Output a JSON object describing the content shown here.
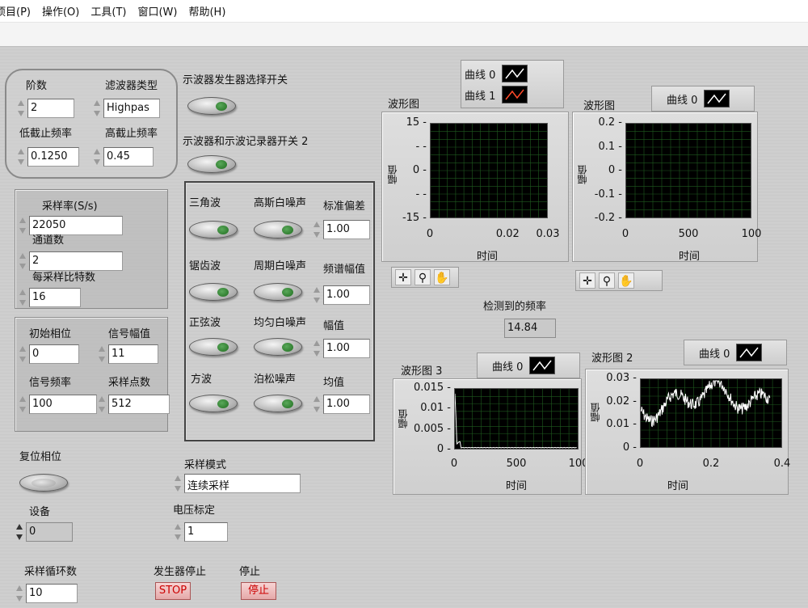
{
  "menu": [
    "项目(P)",
    "操作(O)",
    "工具(T)",
    "窗口(W)",
    "帮助(H)"
  ],
  "filter": {
    "order_label": "阶数",
    "order_value": "2",
    "type_label": "滤波器类型",
    "type_value": "Highpas",
    "low_label": "低截止频率",
    "low_value": "0.1250",
    "high_label": "高截止频率",
    "high_value": "0.45"
  },
  "sampling": {
    "rate_label": "采样率(S/s)",
    "rate_value": "22050",
    "channels_label": "通道数",
    "channels_value": "2",
    "bits_label": "每采样比特数",
    "bits_value": "16"
  },
  "signal": {
    "phase_label": "初始相位",
    "phase_value": "0",
    "amp_label": "信号幅值",
    "amp_value": "11",
    "freq_label": "信号频率",
    "freq_value": "100",
    "points_label": "采样点数",
    "points_value": "512"
  },
  "reset_phase_label": "复位相位",
  "device_label": "设备",
  "device_value": "0",
  "loop_label": "采样循环数",
  "loop_value": "10",
  "gen_stop_label": "发生器停止",
  "gen_stop_button": "STOP",
  "stop_label": "停止",
  "stop_button": "停止",
  "switch1_label": "示波器发生器选择开关",
  "switch2_label": "示波器和示波记录器开关 2",
  "waves": {
    "triangle": "三角波",
    "gauss": "高斯白噪声",
    "stddev_label": "标准偏差",
    "stddev_value": "1.00",
    "saw": "锯齿波",
    "periodic": "周期白噪声",
    "spectrum_label": "频谱幅值",
    "spectrum_value": "1.00",
    "sine": "正弦波",
    "uniform": "均匀白噪声",
    "amp_label": "幅值",
    "amp_value": "1.00",
    "square": "方波",
    "poisson": "泊松噪声",
    "mean_label": "均值",
    "mean_value": "1.00"
  },
  "mode_label": "采样模式",
  "mode_value": "连续采样",
  "voltage_label": "电压标定",
  "voltage_value": "1",
  "freq_detect_label": "检测到的频率",
  "freq_detect_value": "14.84",
  "graphs": {
    "g1": {
      "title": "波形图",
      "ylabel": "幅值",
      "xlabel": "时间",
      "legend": [
        "曲线 0",
        "曲线 1"
      ],
      "yticks": [
        "15",
        "-",
        "0",
        "-",
        "-15"
      ],
      "xticks": [
        "0",
        "0.02",
        "0.03"
      ]
    },
    "g2": {
      "title": "波形图",
      "ylabel": "幅值",
      "xlabel": "时间",
      "legend": [
        "曲线 0"
      ],
      "yticks": [
        "0.2",
        "0.1",
        "0",
        "-0.1",
        "-0.2"
      ],
      "xticks": [
        "0",
        "500",
        "100"
      ]
    },
    "g3": {
      "title": "波形图 3",
      "ylabel": "幅值",
      "xlabel": "时间",
      "legend": [
        "曲线 0"
      ],
      "yticks": [
        "0.015",
        "0.01",
        "0.005",
        "0"
      ],
      "xticks": [
        "0",
        "500",
        "100"
      ]
    },
    "g4": {
      "title": "波形图 2",
      "ylabel": "幅值",
      "xlabel": "时间",
      "legend": [
        "曲线 0"
      ],
      "yticks": [
        "0.03",
        "0.02",
        "0.01",
        "0"
      ],
      "xticks": [
        "0",
        "0.2",
        "0.4"
      ]
    }
  },
  "colors": {
    "plot_bg": "#000000",
    "grid": "#1f5a1f",
    "trace": "#ffffff",
    "curve1": "#ff4a2a"
  }
}
